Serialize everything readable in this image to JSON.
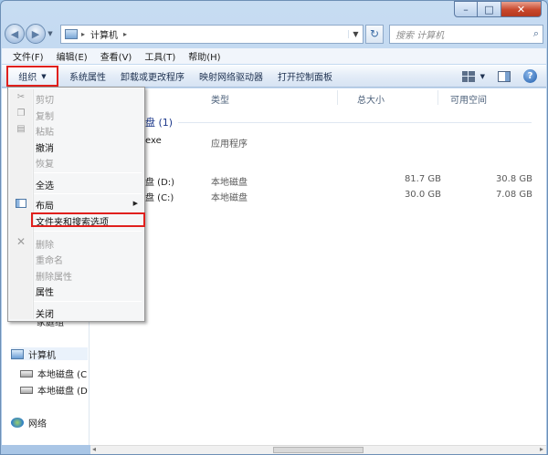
{
  "window": {
    "caption_buttons": {
      "minimize": "–",
      "maximize": "□",
      "close": "✕"
    }
  },
  "address": {
    "path_sep": "▸",
    "path": "计算机",
    "path_end_sep": "▸",
    "refresh": "↻",
    "search_placeholder": "搜索 计算机",
    "back_arrow": "◀",
    "forward_arrow": "▶"
  },
  "menubar": [
    "文件(F)",
    "编辑(E)",
    "查看(V)",
    "工具(T)",
    "帮助(H)"
  ],
  "cmdbar": {
    "organize": "组织",
    "organize_arrow": "▼",
    "system_props": "系统属性",
    "uninstall": "卸载或更改程序",
    "map_drive": "映射网络驱动器",
    "control_panel": "打开控制面板",
    "views_arrow": "▼",
    "help": "?"
  },
  "columns": [
    "类型",
    "总大小",
    "可用空间"
  ],
  "groups": [
    {
      "label": "盘 (1)"
    }
  ],
  "files": [
    {
      "name": "exe",
      "type": "应用程序",
      "total": "",
      "free": ""
    },
    {
      "name": "盘 (D:)",
      "type": "本地磁盘",
      "total": "81.7 GB",
      "free": "30.8 GB"
    },
    {
      "name": "盘 (C:)",
      "type": "本地磁盘",
      "total": "30.0 GB",
      "free": "7.08 GB"
    }
  ],
  "nav": {
    "partial_item": "家庭组",
    "computer": "计算机",
    "drive1": "本地磁盘 (C",
    "drive2": "本地磁盘 (D",
    "network": "网络"
  },
  "menu": {
    "cut": "剪切",
    "copy": "复制",
    "paste": "粘贴",
    "undo": "撤消",
    "redo": "恢复",
    "select_all": "全选",
    "layout": "布局",
    "folder_options": "文件夹和搜索选项",
    "delete": "删除",
    "rename": "重命名",
    "remove_props": "删除属性",
    "properties": "属性",
    "close": "关闭",
    "submenu_arrow": "▶",
    "cut_icon": "✂",
    "copy_icon": "❐",
    "paste_icon": "▤",
    "delete_icon": "✕"
  },
  "scroll": {
    "left": "◂",
    "right": "▸"
  }
}
